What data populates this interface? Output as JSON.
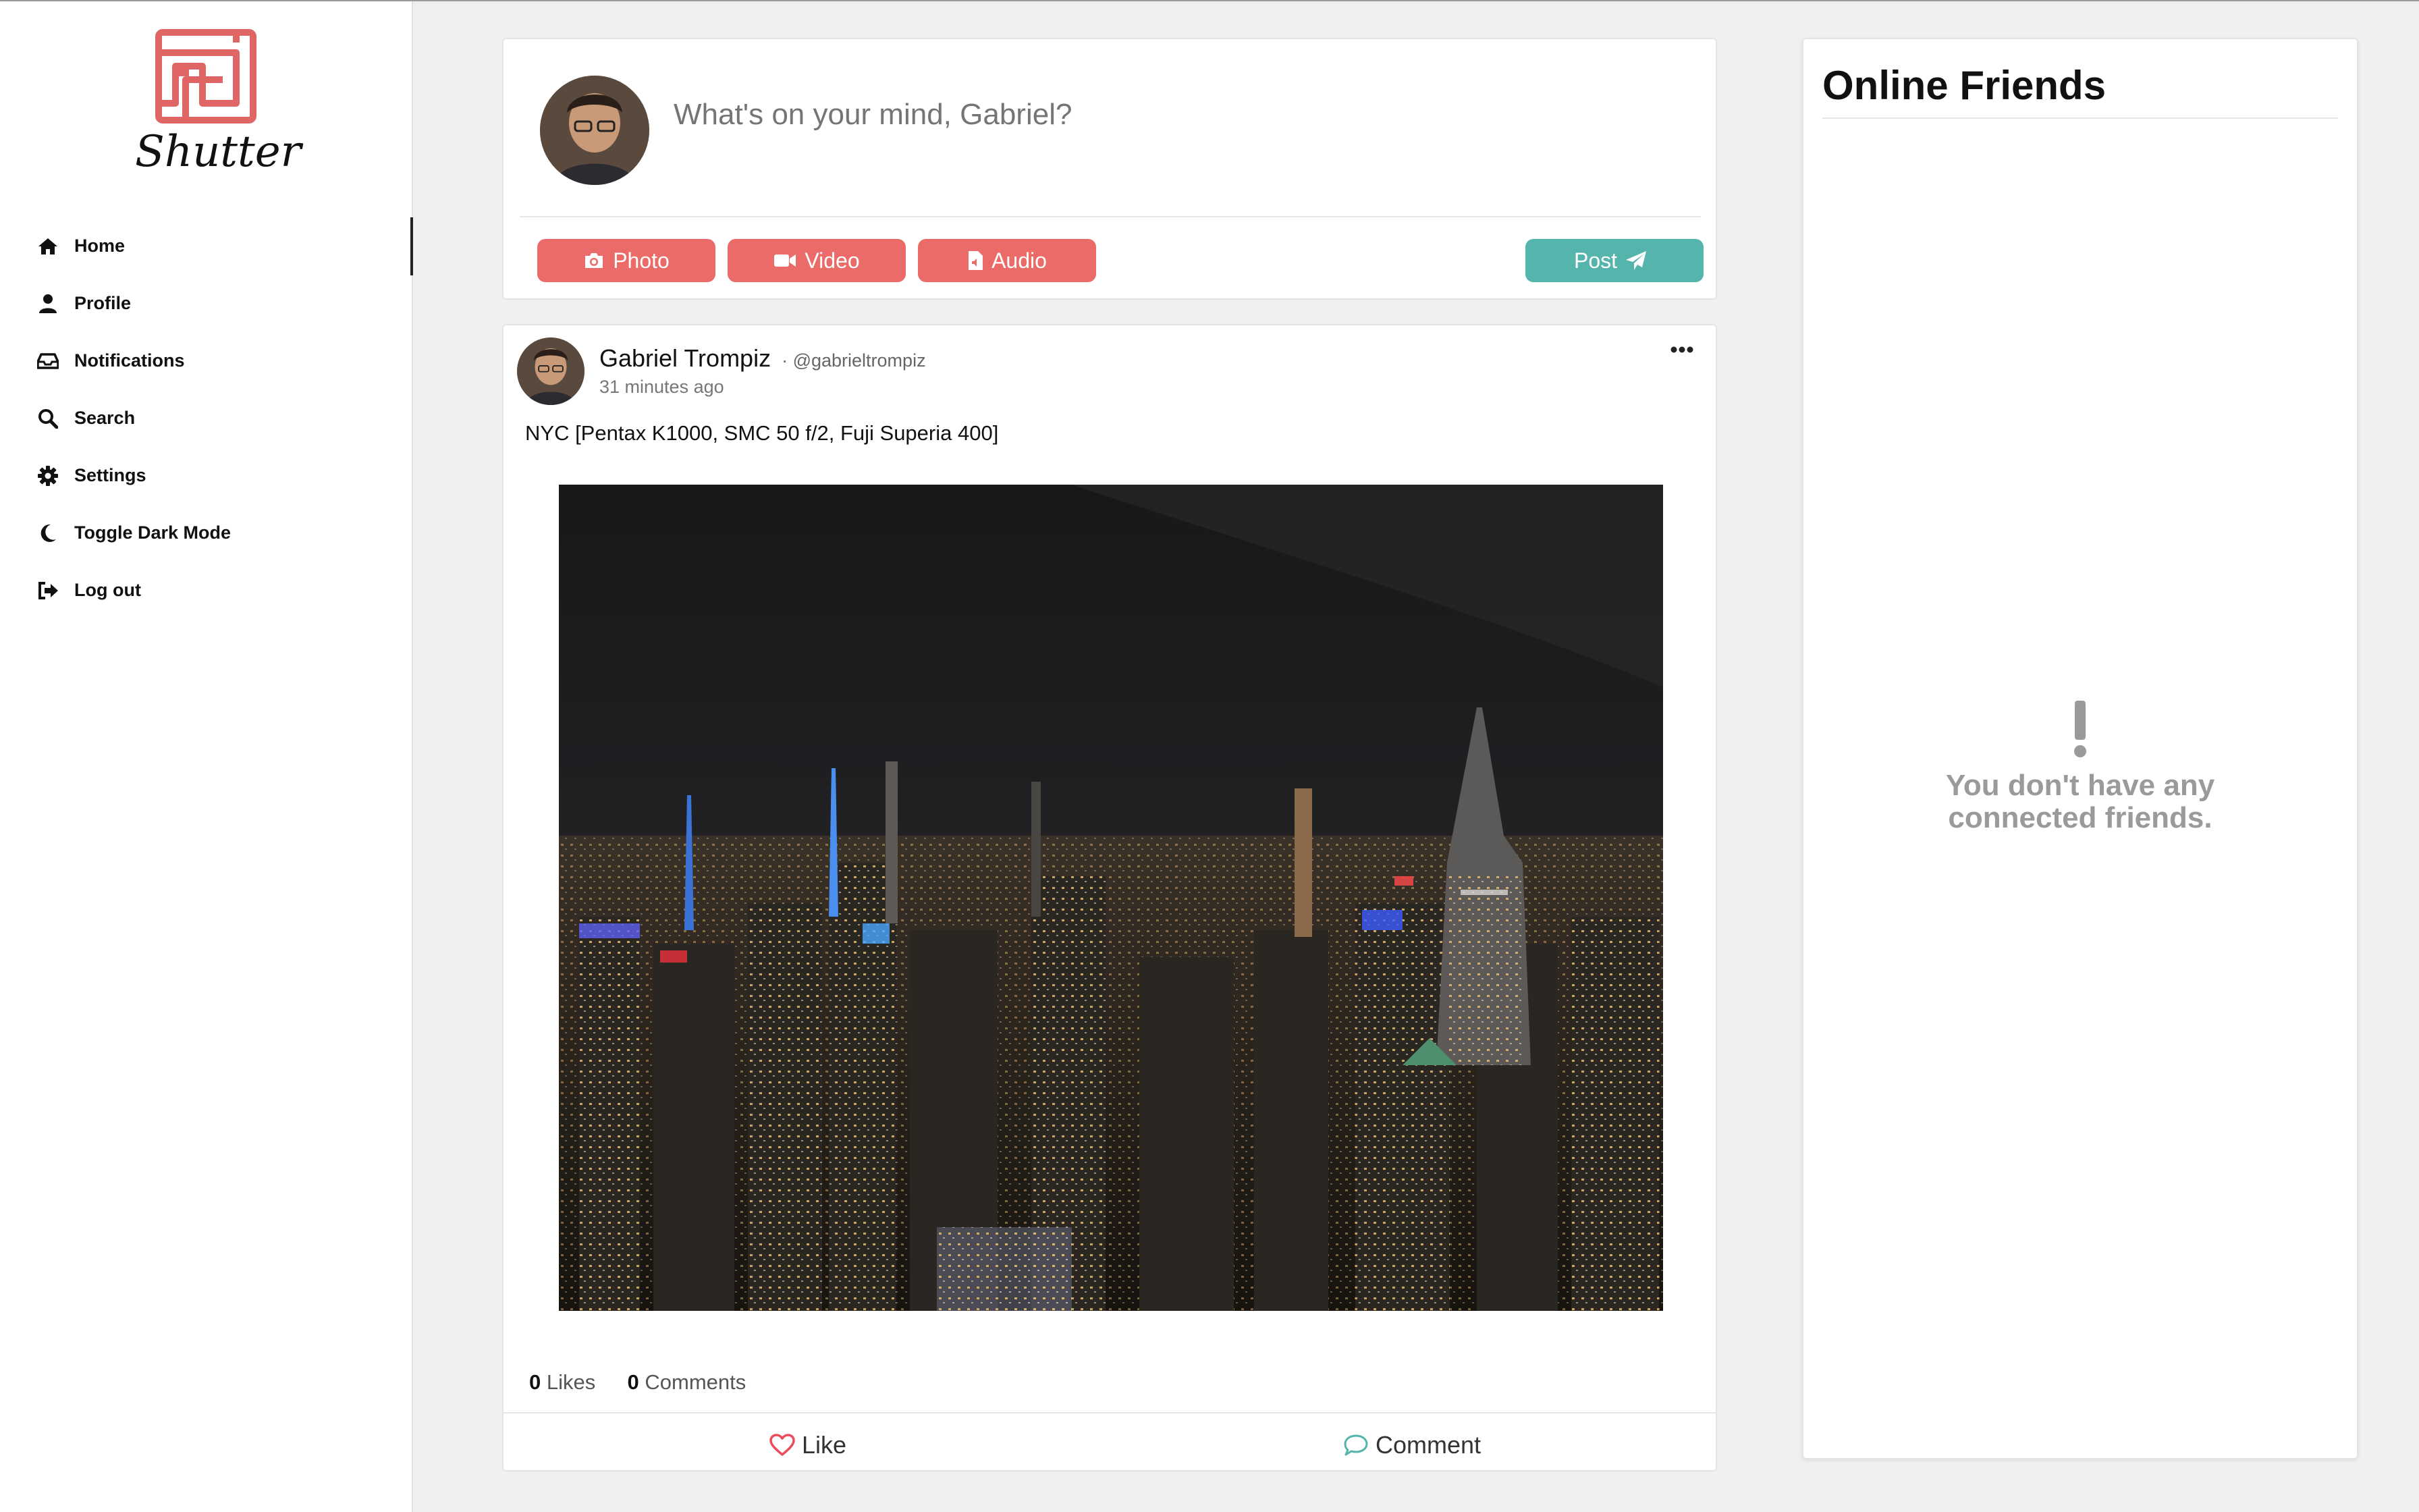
{
  "app": {
    "logo_text": "Shutter",
    "accent_red": "#ea6b68",
    "accent_teal": "#55b4ac"
  },
  "sidebar": {
    "items": [
      {
        "label": "Home",
        "icon": "home-icon",
        "active": true
      },
      {
        "label": "Profile",
        "icon": "user-icon",
        "active": false
      },
      {
        "label": "Notifications",
        "icon": "inbox-icon",
        "active": false
      },
      {
        "label": "Search",
        "icon": "search-icon",
        "active": false
      },
      {
        "label": "Settings",
        "icon": "gear-icon",
        "active": false
      },
      {
        "label": "Toggle Dark Mode",
        "icon": "moon-icon",
        "active": false
      },
      {
        "label": "Log out",
        "icon": "logout-icon",
        "active": false
      }
    ]
  },
  "composer": {
    "placeholder": "What's on your mind, Gabriel?",
    "photo_label": "Photo",
    "video_label": "Video",
    "audio_label": "Audio",
    "post_label": "Post"
  },
  "post": {
    "author": "Gabriel Trompiz",
    "handle": "· @gabrieltrompiz",
    "time": "31 minutes ago",
    "caption": "NYC [Pentax K1000, SMC 50 f/2, Fuji Superia 400]",
    "likes_count": "0",
    "likes_label": "Likes",
    "comments_count": "0",
    "comments_label": "Comments",
    "like_action": "Like",
    "comment_action": "Comment"
  },
  "friends": {
    "title": "Online Friends",
    "empty_line1": "You don't have any",
    "empty_line2": "connected friends."
  }
}
